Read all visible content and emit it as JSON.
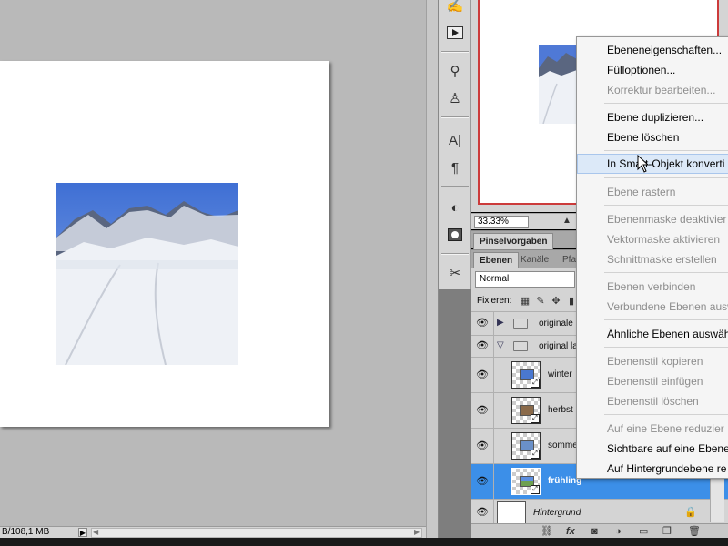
{
  "status_bar": {
    "doc_size": "B/108,1 MB",
    "arrow": "▶",
    "scroll_left": "◀",
    "scroll_right": "▶"
  },
  "navigator": {
    "zoom": "33.33%"
  },
  "panel_tabs": {
    "brush_presets": "Pinselvorgaben",
    "layers": "Ebenen",
    "channels": "Kanäle",
    "paths_partial": "Pfa"
  },
  "layers_panel": {
    "blend_mode": "Normal",
    "lock_label": "Fixieren:",
    "layers": [
      {
        "name": "originale",
        "type": "group",
        "expanded": false
      },
      {
        "name": "original la",
        "type": "group",
        "expanded": true
      },
      {
        "name": "winter",
        "type": "smart"
      },
      {
        "name": "herbst",
        "type": "smart"
      },
      {
        "name": "somme",
        "type": "smart"
      },
      {
        "name": "frühling",
        "type": "smart",
        "selected": true
      },
      {
        "name": "Hintergrund",
        "type": "background",
        "locked": true
      }
    ]
  },
  "context_menu": {
    "items": [
      {
        "label": "Ebeneneigenschaften...",
        "disabled": false
      },
      {
        "label": "Fülloptionen...",
        "disabled": false
      },
      {
        "label": "Korrektur bearbeiten...",
        "disabled": true
      },
      {
        "label": "Ebene duplizieren...",
        "disabled": false
      },
      {
        "label": "Ebene löschen",
        "disabled": false
      },
      {
        "label": "In Smart-Objekt konverti",
        "disabled": false,
        "hovered": true
      },
      {
        "label": "Ebene rastern",
        "disabled": true
      },
      {
        "label": "Ebenenmaske deaktivier",
        "disabled": true
      },
      {
        "label": "Vektormaske aktivieren",
        "disabled": true
      },
      {
        "label": "Schnittmaske erstellen",
        "disabled": true
      },
      {
        "label": "Ebenen verbinden",
        "disabled": true
      },
      {
        "label": "Verbundene Ebenen ausw",
        "disabled": true
      },
      {
        "label": "Ähnliche Ebenen auswäh",
        "disabled": false
      },
      {
        "label": "Ebenenstil kopieren",
        "disabled": true
      },
      {
        "label": "Ebenenstil einfügen",
        "disabled": true
      },
      {
        "label": "Ebenenstil löschen",
        "disabled": true
      },
      {
        "label": "Auf eine Ebene reduzier",
        "disabled": true
      },
      {
        "label": "Sichtbare auf eine Ebene",
        "disabled": false
      },
      {
        "label": "Auf Hintergrundebene re",
        "disabled": false
      }
    ]
  },
  "colors": {
    "selection": "#3c8fe8",
    "menu_hover": "#dce9f8",
    "nav_frame": "#cc3b3b",
    "workspace": "#b9b9b9"
  },
  "icons": {
    "tools": [
      "history-brush-icon",
      "actions-play-icon",
      "clone-source-icon",
      "stamp-icon",
      "character-icon",
      "paragraph-icon",
      "adjustments-icon",
      "masks-icon",
      "tools-preset-icon"
    ],
    "footer": [
      "link-icon",
      "fx-icon",
      "mask-icon",
      "adjustment-layer-icon",
      "new-group-icon",
      "new-layer-icon",
      "trash-icon"
    ]
  }
}
